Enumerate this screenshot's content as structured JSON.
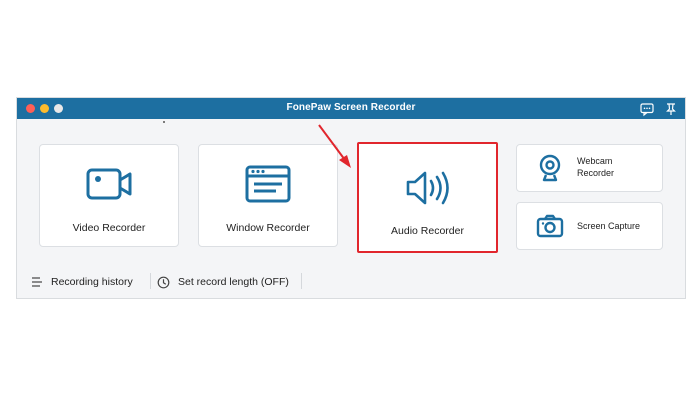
{
  "window": {
    "title": "FonePaw Screen Recorder"
  },
  "titlebar_icons": [
    "chat-icon",
    "pin-icon"
  ],
  "cards": {
    "video_label": "Video Recorder",
    "window_label": "Window Recorder",
    "audio_label": "Audio Recorder",
    "webcam_label_line1": "Webcam",
    "webcam_label_line2": "Recorder",
    "capture_label": "Screen Capture"
  },
  "bottom": {
    "history_label": "Recording history",
    "length_label": "Set record length (OFF)"
  },
  "colors": {
    "titlebar": "#1d6fa1",
    "icon": "#1d6fa1",
    "highlight": "#e1262d"
  }
}
